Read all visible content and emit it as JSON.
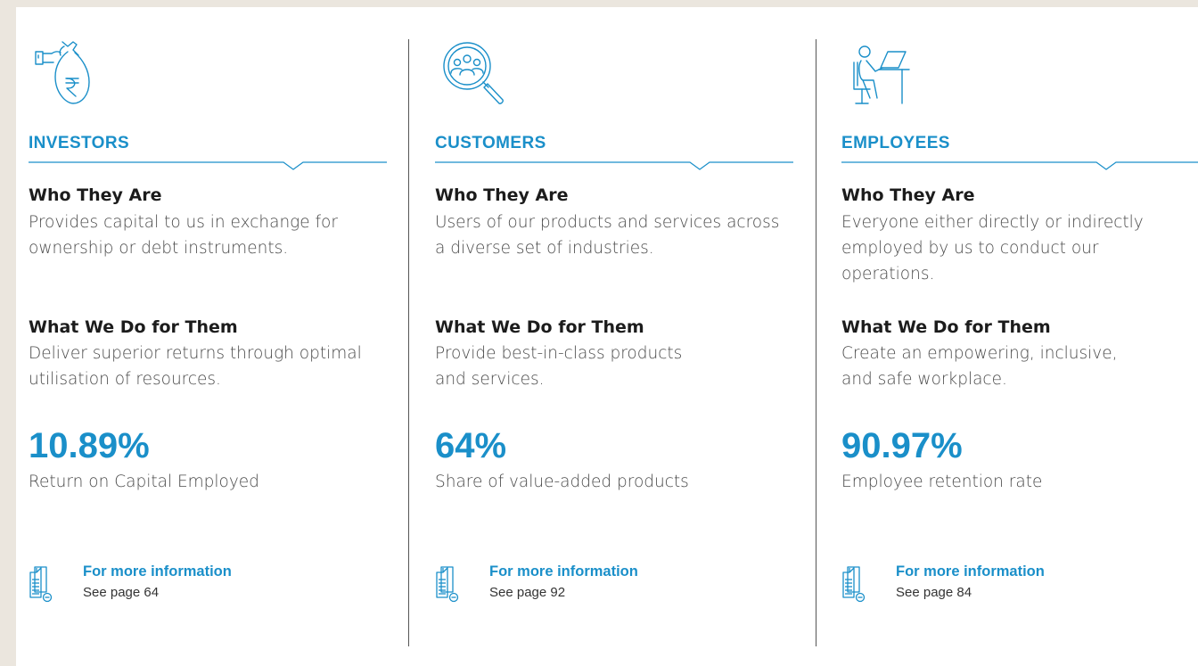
{
  "colors": {
    "accent": "#1a8fc9",
    "background": "#ebe6de",
    "panel": "#ffffff",
    "text": "#4a4a4a",
    "heading_text": "#1c1c1c"
  },
  "columns": [
    {
      "icon": "money-bag-rupee-icon",
      "heading": "INVESTORS",
      "who_title": "Who They Are",
      "who_text": "Provides capital to us in exchange for ownership or debt instruments.",
      "what_title": "What We Do for Them",
      "what_text": "Deliver superior returns through optimal utilisation of resources.",
      "metric": "10.89%",
      "metric_label": "Return on Capital Employed",
      "more_title": "For more information",
      "more_page": "See page 64"
    },
    {
      "icon": "people-magnifier-icon",
      "heading": "CUSTOMERS",
      "who_title": "Who They Are",
      "who_text": "Users of our products and services across a diverse set of industries.",
      "what_title": "What We Do for Them",
      "what_text": "Provide best-in-class products and services.",
      "metric": "64%",
      "metric_label": "Share of value-added products",
      "more_title": "For more information",
      "more_page": "See page 92"
    },
    {
      "icon": "employee-desk-icon",
      "heading": "EMPLOYEES",
      "who_title": "Who They Are",
      "who_text": "Everyone either directly or indirectly employed by us to conduct our operations.",
      "what_title": "What We Do for Them",
      "what_text": "Create an empowering, inclusive, and safe workplace.",
      "metric": "90.97%",
      "metric_label": "Employee retention rate",
      "more_title": "For more information",
      "more_page": "See page 84"
    }
  ]
}
